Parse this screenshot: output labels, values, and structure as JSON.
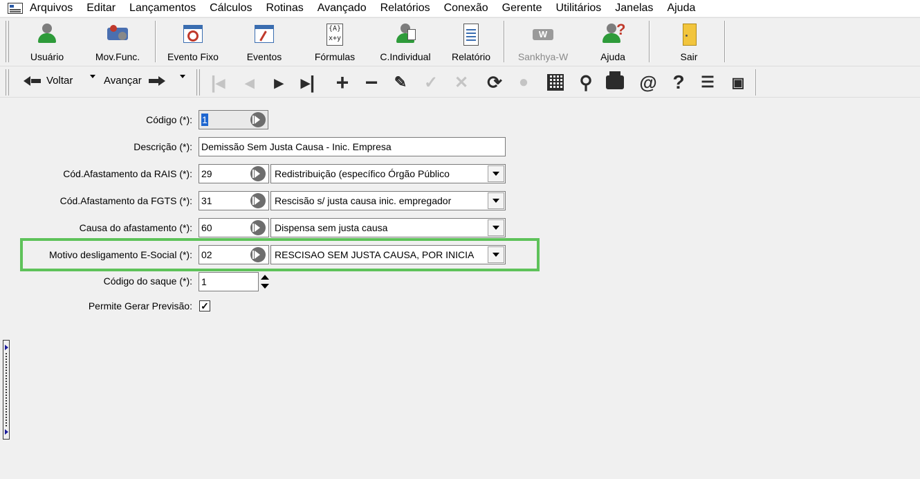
{
  "menu": [
    "Arquivos",
    "Editar",
    "Lançamentos",
    "Cálculos",
    "Rotinas",
    "Avançado",
    "Relatórios",
    "Conexão",
    "Gerente",
    "Utilitários",
    "Janelas",
    "Ajuda"
  ],
  "toolbar": {
    "usuario": "Usuário",
    "movfunc": "Mov.Func.",
    "evento_fixo": "Evento Fixo",
    "eventos": "Eventos",
    "formulas": "Fórmulas",
    "cindividual": "C.Individual",
    "relatorio": "Relatório",
    "sankhya": "Sankhya-W",
    "ajuda": "Ajuda",
    "sair": "Sair"
  },
  "nav": {
    "voltar": "Voltar",
    "avancar": "Avançar"
  },
  "form": {
    "codigo": {
      "label": "Código (*):",
      "value": "1"
    },
    "descricao": {
      "label": "Descrição (*):",
      "value": "Demissão Sem Justa Causa - Inic. Empresa"
    },
    "rais": {
      "label": "Cód.Afastamento da RAIS (*):",
      "value": "29",
      "option": "Redistribuição (específico Órgão Público"
    },
    "fgts": {
      "label": "Cód.Afastamento da FGTS (*):",
      "value": "31",
      "option": "Rescisão s/ justa causa inic. empregador"
    },
    "causa": {
      "label": "Causa do afastamento (*):",
      "value": "60",
      "option": "Dispensa sem justa causa"
    },
    "motivo": {
      "label": "Motivo desligamento E-Social (*):",
      "value": "02",
      "option": "RESCISAO SEM JUSTA CAUSA, POR INICIA"
    },
    "saque": {
      "label": "Código do saque (*):",
      "value": "1"
    },
    "previsao": {
      "label": "Permite Gerar Previsão:",
      "checked": "✓"
    }
  },
  "colors": {
    "highlight": "#5ec25a",
    "accent": "#1e66d0"
  }
}
